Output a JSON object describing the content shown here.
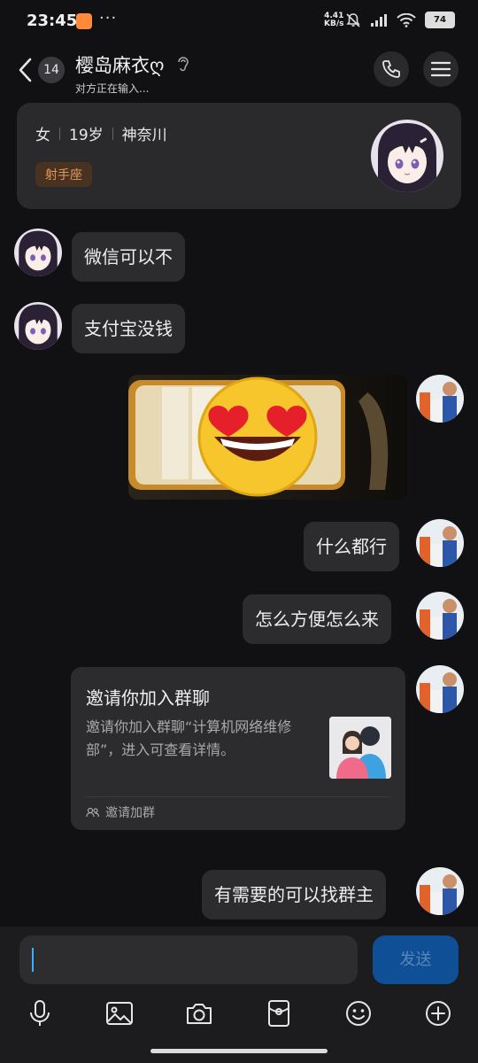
{
  "status_bar": {
    "time": "23:45",
    "net_rate_value": "4.41",
    "net_rate_unit": "KB/s",
    "battery": "74",
    "overflow_dots": "···"
  },
  "header": {
    "unread_count": "14",
    "contact_name": "樱岛麻衣ღ",
    "typing_status": "对方正在输入..."
  },
  "profile": {
    "gender": "女",
    "age": "19岁",
    "location": "神奈川",
    "zodiac_tag": "射手座"
  },
  "messages": {
    "m1": "微信可以不",
    "m2": "支付宝没钱",
    "m4": "什么都行",
    "m5": "怎么方便怎么来",
    "m7": "有需要的可以找群主"
  },
  "invite_card": {
    "title": "邀请你加入群聊",
    "description": "邀请你加入群聊“计算机网络维修部”，进入可查看详情。",
    "footer_label": "邀请加群"
  },
  "input_bar": {
    "text_value": "",
    "send_label": "发送"
  },
  "icons": {
    "back": "chevron-left-icon",
    "ear": "ear-icon",
    "phone": "phone-icon",
    "menu": "menu-icon",
    "voice": "mic-icon",
    "image": "image-icon",
    "camera": "camera-icon",
    "red_packet": "red-packet-icon",
    "emoji": "emoji-icon",
    "plus": "plus-icon"
  },
  "colors": {
    "background": "#111113",
    "bubble": "#2c2c2f",
    "send_button": "#0e4f96",
    "zodiac_tag_text": "#e39a5a",
    "cursor": "#3ab0ff"
  }
}
